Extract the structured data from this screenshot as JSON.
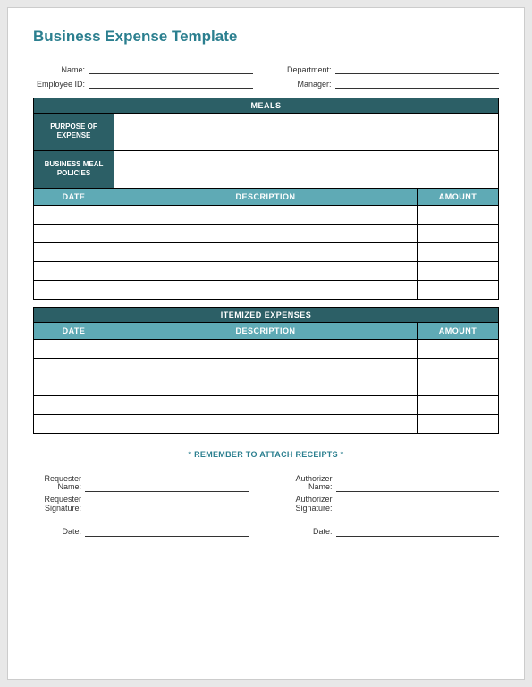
{
  "title": "Business Expense Template",
  "header": {
    "name_label": "Name:",
    "department_label": "Department:",
    "employee_id_label": "Employee ID:",
    "manager_label": "Manager:"
  },
  "meals": {
    "section_title": "MEALS",
    "purpose_label": "PURPOSE OF EXPENSE",
    "policies_label": "BUSINESS MEAL POLICIES",
    "col_date": "DATE",
    "col_description": "DESCRIPTION",
    "col_amount": "AMOUNT",
    "rows": [
      {
        "date": "",
        "description": "",
        "amount": ""
      },
      {
        "date": "",
        "description": "",
        "amount": ""
      },
      {
        "date": "",
        "description": "",
        "amount": ""
      },
      {
        "date": "",
        "description": "",
        "amount": ""
      },
      {
        "date": "",
        "description": "",
        "amount": ""
      }
    ]
  },
  "itemized": {
    "section_title": "ITEMIZED EXPENSES",
    "col_date": "DATE",
    "col_description": "DESCRIPTION",
    "col_amount": "AMOUNT",
    "rows": [
      {
        "date": "",
        "description": "",
        "amount": ""
      },
      {
        "date": "",
        "description": "",
        "amount": ""
      },
      {
        "date": "",
        "description": "",
        "amount": ""
      },
      {
        "date": "",
        "description": "",
        "amount": ""
      },
      {
        "date": "",
        "description": "",
        "amount": ""
      }
    ]
  },
  "reminder": "* REMEMBER TO ATTACH RECEIPTS *",
  "signatures": {
    "requester_name_label": "Requester Name:",
    "requester_signature_label": "Requester Signature:",
    "requester_date_label": "Date:",
    "authorizer_name_label": "Authorizer Name:",
    "authorizer_signature_label": "Authorizer Signature:",
    "authorizer_date_label": "Date:"
  }
}
